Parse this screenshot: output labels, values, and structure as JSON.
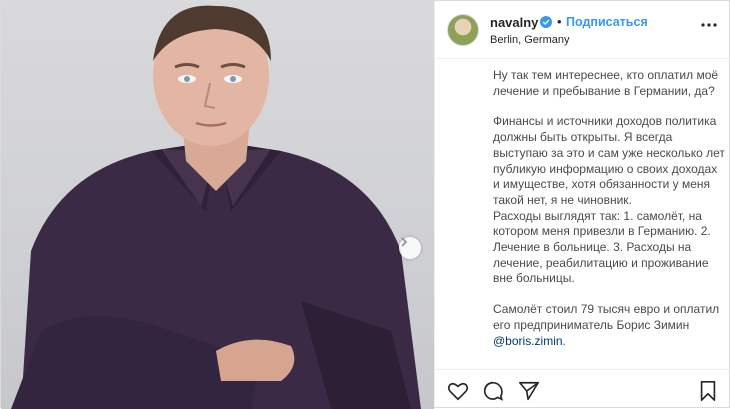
{
  "header": {
    "username": "navalny",
    "dot": "•",
    "follow_label": "Подписаться",
    "location": "Berlin, Germany"
  },
  "caption": {
    "p1": "Ну так тем интереснее, кто оплатил моё лечение и пребывание в Германии, да?",
    "p2": "Финансы и источники доходов политика должны быть открыты. Я всегда выступаю за это и сам уже несколько лет публикую информацию о своих доходах и имуществе, хотя обязанности у меня такой нет, я не чиновник.",
    "p3": "Расходы выглядят так: 1. самолёт, на котором меня привезли в Германию. 2. Лечение в больнице. 3. Расходы на лечение, реабилитацию и проживание вне больницы.",
    "p4_text": "Самолёт стоил 79 тысяч евро и оплатил его предприниматель Борис Зимин ",
    "p4_mention": "@boris.zimin",
    "p4_end": "."
  },
  "icons": {
    "verified": "verified-badge-icon",
    "more": "more-options-icon",
    "like": "heart-icon",
    "comment": "comment-icon",
    "share": "share-icon",
    "save": "bookmark-icon",
    "carousel": "chevron-right-icon"
  },
  "colors": {
    "link_blue": "#3897f0",
    "mention": "#00376b",
    "text": "#262626",
    "shirt": "#3a2a45"
  }
}
